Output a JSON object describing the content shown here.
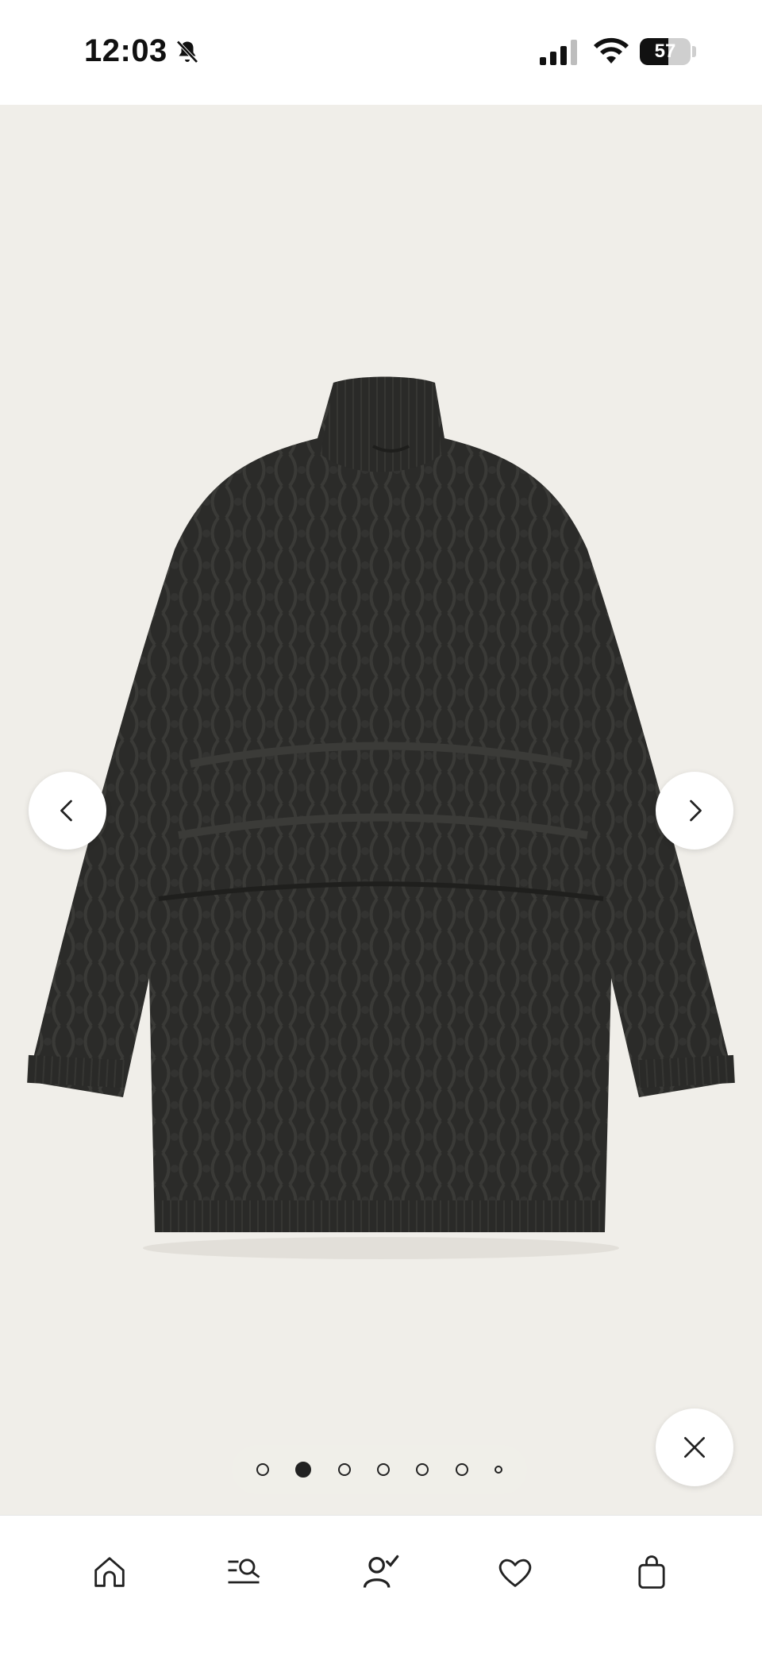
{
  "status_bar": {
    "time": "12:03",
    "battery_level": "57",
    "battery_fraction": 0.57,
    "icons": [
      "bell-muted-icon",
      "cellular-signal-icon",
      "wifi-icon",
      "battery-icon"
    ]
  },
  "gallery": {
    "image_description": "sweater-product-image",
    "background_color": "#f0eee9",
    "item_color": "#2a2a28",
    "slide_count": 7,
    "active_slide": 2,
    "controls": [
      "chevron-left-icon",
      "chevron-right-icon",
      "close-icon"
    ]
  },
  "tab_bar": {
    "tabs": [
      {
        "name": "home",
        "icon": "home-icon"
      },
      {
        "name": "search",
        "icon": "search-list-icon"
      },
      {
        "name": "account",
        "icon": "user-check-icon"
      },
      {
        "name": "favorites",
        "icon": "heart-icon"
      },
      {
        "name": "bag",
        "icon": "shopping-bag-icon"
      }
    ]
  }
}
